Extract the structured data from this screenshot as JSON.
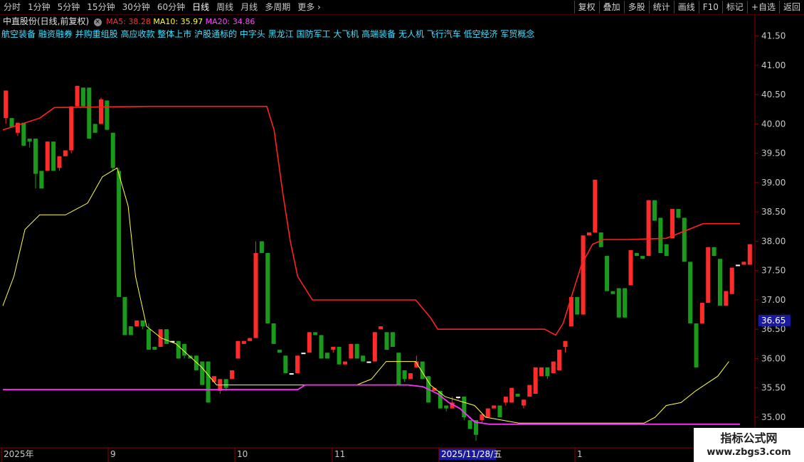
{
  "toolbar": {
    "timeframes": [
      "分时",
      "1分钟",
      "5分钟",
      "15分钟",
      "30分钟",
      "60分钟",
      "日线",
      "周线",
      "月线",
      "多周期",
      "更多"
    ],
    "active_timeframe": "日线",
    "more_chevron": "›",
    "tools": [
      "复权",
      "叠加",
      "多股",
      "统计",
      "画线",
      "F10",
      "标记",
      "+自选",
      "返回"
    ]
  },
  "info": {
    "stock_name": "中直股份(日线,前复权)",
    "close_icon": "×",
    "ma5_label": "MA5: 38.28",
    "ma10_label": "MA10: 35.97",
    "ma20_label": "MA20: 34.86"
  },
  "concepts": "航空装备 融资融券 并购重组股 高应收款 整体上市 沪股通标的 中字头 黑龙江 国防军工 大飞机 高端装备 无人机 飞行汽车 低空经济 军贸概念",
  "price_axis": {
    "labels": [
      "41.50",
      "41.00",
      "40.50",
      "40.00",
      "39.50",
      "39.00",
      "38.50",
      "38.00",
      "37.50",
      "37.00",
      "36.50",
      "36.00",
      "35.50",
      "35.00"
    ],
    "current_price": "36.65"
  },
  "time_axis": {
    "labels": [
      "2025年",
      "9",
      "10",
      "11",
      "2025/11/28/五",
      "1"
    ]
  },
  "colors": {
    "up": "#ff2b2b",
    "down": "#1a9a1a",
    "ma5": "#ff2020",
    "ma10": "#ffff40",
    "ma20": "#ff30ff",
    "axis": "#8b0000",
    "price_highlight_bg": "#1a1aa0"
  },
  "watermark": {
    "title": "指标公式网",
    "url": "www.zbgs3.com"
  },
  "chart_data": {
    "type": "candlestick",
    "ylim": [
      34.6,
      41.75
    ],
    "candles": [
      {
        "o": 40.1,
        "c": 40.57,
        "h": 40.57,
        "l": 40.0
      },
      {
        "o": 40.1,
        "c": 39.95,
        "h": 40.1,
        "l": 39.95
      },
      {
        "o": 39.85,
        "c": 40.02,
        "h": 40.02,
        "l": 39.8
      },
      {
        "o": 40.02,
        "c": 39.63,
        "h": 40.02,
        "l": 39.63
      },
      {
        "o": 39.75,
        "c": 39.7,
        "h": 39.75,
        "l": 39.6
      },
      {
        "o": 39.75,
        "c": 39.15,
        "h": 39.75,
        "l": 38.9
      },
      {
        "o": 39.2,
        "c": 38.9,
        "h": 39.2,
        "l": 38.9
      },
      {
        "o": 39.2,
        "c": 39.7,
        "h": 39.7,
        "l": 39.2
      },
      {
        "o": 39.7,
        "c": 39.2,
        "h": 39.7,
        "l": 39.2
      },
      {
        "o": 39.25,
        "c": 39.45,
        "h": 39.45,
        "l": 39.2
      },
      {
        "o": 39.45,
        "c": 39.55,
        "h": 39.55,
        "l": 39.45
      },
      {
        "o": 39.55,
        "c": 40.3,
        "h": 40.3,
        "l": 39.5
      },
      {
        "o": 40.3,
        "c": 40.65,
        "h": 40.65,
        "l": 40.3
      },
      {
        "o": 40.62,
        "c": 40.3,
        "h": 40.62,
        "l": 40.3
      },
      {
        "o": 40.62,
        "c": 39.75,
        "h": 40.62,
        "l": 39.75
      },
      {
        "o": 40.0,
        "c": 39.85,
        "h": 40.0,
        "l": 39.85
      },
      {
        "o": 40.0,
        "c": 40.42,
        "h": 40.45,
        "l": 40.0
      },
      {
        "o": 40.4,
        "c": 39.9,
        "h": 40.4,
        "l": 39.9
      },
      {
        "o": 39.85,
        "c": 39.25,
        "h": 39.85,
        "l": 39.2
      },
      {
        "o": 39.2,
        "c": 37.05,
        "h": 39.25,
        "l": 37.05
      },
      {
        "o": 37.05,
        "c": 36.4,
        "h": 37.05,
        "l": 36.4
      },
      {
        "o": 36.55,
        "c": 36.4,
        "h": 36.55,
        "l": 36.4
      },
      {
        "o": 36.55,
        "c": 36.65,
        "h": 36.65,
        "l": 36.55
      },
      {
        "o": 36.65,
        "c": 36.55,
        "h": 36.65,
        "l": 36.5
      },
      {
        "o": 36.5,
        "c": 36.15,
        "h": 36.6,
        "l": 36.15
      },
      {
        "o": 36.2,
        "c": 36.15,
        "h": 36.2,
        "l": 36.15
      },
      {
        "o": 36.2,
        "c": 36.5,
        "h": 36.5,
        "l": 36.2
      },
      {
        "o": 36.5,
        "c": 36.25,
        "h": 36.5,
        "l": 36.25
      },
      {
        "o": 36.3,
        "c": 36.3,
        "h": 36.3,
        "l": 36.3
      },
      {
        "o": 36.3,
        "c": 36.0,
        "h": 36.3,
        "l": 36.0
      },
      {
        "o": 36.25,
        "c": 36.05,
        "h": 36.25,
        "l": 36.0
      },
      {
        "o": 36.05,
        "c": 36.0,
        "h": 36.05,
        "l": 36.0
      },
      {
        "o": 36.05,
        "c": 35.8,
        "h": 36.05,
        "l": 35.8
      },
      {
        "o": 35.95,
        "c": 35.55,
        "h": 35.95,
        "l": 35.55
      },
      {
        "o": 35.95,
        "c": 35.25,
        "h": 35.95,
        "l": 35.25
      },
      {
        "o": 35.6,
        "c": 35.7,
        "h": 35.7,
        "l": 35.6
      },
      {
        "o": 35.45,
        "c": 35.65,
        "h": 35.65,
        "l": 35.4
      },
      {
        "o": 35.65,
        "c": 35.5,
        "h": 35.65,
        "l": 35.45
      },
      {
        "o": 35.65,
        "c": 35.8,
        "h": 35.8,
        "l": 35.65
      },
      {
        "o": 36.0,
        "c": 36.3,
        "h": 36.3,
        "l": 36.0
      },
      {
        "o": 36.25,
        "c": 36.3,
        "h": 36.3,
        "l": 36.25
      },
      {
        "o": 36.3,
        "c": 36.35,
        "h": 36.35,
        "l": 36.3
      },
      {
        "o": 36.35,
        "c": 37.8,
        "h": 38.0,
        "l": 36.35
      },
      {
        "o": 38.0,
        "c": 37.8,
        "h": 38.0,
        "l": 37.8
      },
      {
        "o": 37.8,
        "c": 36.6,
        "h": 37.8,
        "l": 36.6
      },
      {
        "o": 36.6,
        "c": 36.25,
        "h": 36.6,
        "l": 36.25
      },
      {
        "o": 36.15,
        "c": 36.1,
        "h": 36.15,
        "l": 36.1
      },
      {
        "o": 36.05,
        "c": 35.75,
        "h": 36.05,
        "l": 35.75
      },
      {
        "o": 35.75,
        "c": 35.75,
        "h": 35.75,
        "l": 35.75
      },
      {
        "o": 35.75,
        "c": 36.05,
        "h": 36.05,
        "l": 35.75
      },
      {
        "o": 36.1,
        "c": 36.1,
        "h": 36.1,
        "l": 36.1
      },
      {
        "o": 36.1,
        "c": 36.45,
        "h": 36.45,
        "l": 36.1
      },
      {
        "o": 36.45,
        "c": 36.4,
        "h": 36.45,
        "l": 36.4
      },
      {
        "o": 36.4,
        "c": 36.0,
        "h": 36.4,
        "l": 36.0
      },
      {
        "o": 36.1,
        "c": 36.0,
        "h": 36.1,
        "l": 36.0
      },
      {
        "o": 36.15,
        "c": 36.2,
        "h": 36.2,
        "l": 36.1
      },
      {
        "o": 36.2,
        "c": 35.9,
        "h": 36.2,
        "l": 35.9
      },
      {
        "o": 35.9,
        "c": 35.95,
        "h": 35.95,
        "l": 35.9
      },
      {
        "o": 36.0,
        "c": 36.25,
        "h": 36.25,
        "l": 36.0
      },
      {
        "o": 36.25,
        "c": 36.0,
        "h": 36.25,
        "l": 36.0
      },
      {
        "o": 36.05,
        "c": 35.95,
        "h": 36.05,
        "l": 35.95
      },
      {
        "o": 35.95,
        "c": 35.95,
        "h": 35.95,
        "l": 35.95
      },
      {
        "o": 35.95,
        "c": 36.45,
        "h": 36.45,
        "l": 35.95
      },
      {
        "o": 36.5,
        "c": 36.55,
        "h": 36.55,
        "l": 36.5
      },
      {
        "o": 36.45,
        "c": 36.15,
        "h": 36.45,
        "l": 36.15
      },
      {
        "o": 36.45,
        "c": 36.2,
        "h": 36.45,
        "l": 36.2
      },
      {
        "o": 36.1,
        "c": 35.55,
        "h": 36.1,
        "l": 35.55
      },
      {
        "o": 35.8,
        "c": 35.65,
        "h": 35.8,
        "l": 35.6
      },
      {
        "o": 35.65,
        "c": 35.75,
        "h": 35.75,
        "l": 35.65
      },
      {
        "o": 35.85,
        "c": 35.95,
        "h": 36.05,
        "l": 35.85
      },
      {
        "o": 35.95,
        "c": 35.65,
        "h": 35.95,
        "l": 35.65
      },
      {
        "o": 35.7,
        "c": 35.25,
        "h": 35.7,
        "l": 35.25
      },
      {
        "o": 35.45,
        "c": 35.5,
        "h": 35.5,
        "l": 35.45
      },
      {
        "o": 35.45,
        "c": 35.15,
        "h": 35.45,
        "l": 35.15
      },
      {
        "o": 35.2,
        "c": 35.15,
        "h": 35.2,
        "l": 35.1
      },
      {
        "o": 35.15,
        "c": 35.25,
        "h": 35.35,
        "l": 35.15
      },
      {
        "o": 35.35,
        "c": 35.35,
        "h": 35.35,
        "l": 35.3
      },
      {
        "o": 35.35,
        "c": 35.0,
        "h": 35.35,
        "l": 34.95
      },
      {
        "o": 34.95,
        "c": 34.8,
        "h": 34.95,
        "l": 34.8
      },
      {
        "o": 34.95,
        "c": 34.7,
        "h": 34.95,
        "l": 34.6
      },
      {
        "o": 34.95,
        "c": 35.05,
        "h": 35.05,
        "l": 34.9
      },
      {
        "o": 35.0,
        "c": 35.15,
        "h": 35.15,
        "l": 35.0
      },
      {
        "o": 35.15,
        "c": 35.2,
        "h": 35.2,
        "l": 35.15
      },
      {
        "o": 35.2,
        "c": 35.0,
        "h": 35.2,
        "l": 35.0
      },
      {
        "o": 35.25,
        "c": 35.35,
        "h": 35.35,
        "l": 35.2
      },
      {
        "o": 35.25,
        "c": 35.5,
        "h": 35.5,
        "l": 35.25
      },
      {
        "o": 35.4,
        "c": 35.35,
        "h": 35.4,
        "l": 35.35
      },
      {
        "o": 35.2,
        "c": 35.3,
        "h": 35.3,
        "l": 35.15
      },
      {
        "o": 35.35,
        "c": 35.55,
        "h": 35.55,
        "l": 35.35
      },
      {
        "o": 35.4,
        "c": 35.85,
        "h": 35.85,
        "l": 35.4
      },
      {
        "o": 35.7,
        "c": 35.85,
        "h": 35.85,
        "l": 35.7
      },
      {
        "o": 35.85,
        "c": 35.7,
        "h": 35.85,
        "l": 35.65
      },
      {
        "o": 35.75,
        "c": 35.95,
        "h": 35.95,
        "l": 35.75
      },
      {
        "o": 35.8,
        "c": 36.15,
        "h": 36.15,
        "l": 35.8
      },
      {
        "o": 36.2,
        "c": 36.3,
        "h": 36.3,
        "l": 36.1
      },
      {
        "o": 36.55,
        "c": 37.05,
        "h": 37.05,
        "l": 36.55
      },
      {
        "o": 37.05,
        "c": 36.75,
        "h": 37.05,
        "l": 36.75
      },
      {
        "o": 36.75,
        "c": 38.1,
        "h": 38.1,
        "l": 36.75
      },
      {
        "o": 38.1,
        "c": 38.15,
        "h": 38.15,
        "l": 38.1
      },
      {
        "o": 38.15,
        "c": 39.05,
        "h": 39.05,
        "l": 38.15
      },
      {
        "o": 38.15,
        "c": 37.9,
        "h": 38.15,
        "l": 37.9
      },
      {
        "o": 37.75,
        "c": 37.15,
        "h": 37.75,
        "l": 37.15
      },
      {
        "o": 37.15,
        "c": 37.1,
        "h": 37.15,
        "l": 37.1
      },
      {
        "o": 37.2,
        "c": 36.7,
        "h": 37.2,
        "l": 36.7
      },
      {
        "o": 37.2,
        "c": 36.7,
        "h": 37.2,
        "l": 36.7
      },
      {
        "o": 37.25,
        "c": 37.85,
        "h": 37.85,
        "l": 37.25
      },
      {
        "o": 37.8,
        "c": 37.75,
        "h": 37.8,
        "l": 37.75
      },
      {
        "o": 37.75,
        "c": 37.7,
        "h": 37.7,
        "l": 37.7
      },
      {
        "o": 37.75,
        "c": 38.7,
        "h": 38.7,
        "l": 37.75
      },
      {
        "o": 38.7,
        "c": 38.35,
        "h": 38.7,
        "l": 38.35
      },
      {
        "o": 38.4,
        "c": 37.8,
        "h": 38.4,
        "l": 37.8
      },
      {
        "o": 37.95,
        "c": 37.75,
        "h": 37.95,
        "l": 37.75
      },
      {
        "o": 38.05,
        "c": 38.55,
        "h": 38.55,
        "l": 38.05
      },
      {
        "o": 38.55,
        "c": 38.4,
        "h": 38.55,
        "l": 38.4
      },
      {
        "o": 38.4,
        "c": 37.65,
        "h": 38.4,
        "l": 37.65
      },
      {
        "o": 37.65,
        "c": 36.6,
        "h": 37.65,
        "l": 36.6
      },
      {
        "o": 36.6,
        "c": 35.85,
        "h": 36.6,
        "l": 35.85
      },
      {
        "o": 36.6,
        "c": 36.95,
        "h": 36.95,
        "l": 36.6
      },
      {
        "o": 36.95,
        "c": 37.9,
        "h": 37.9,
        "l": 36.95
      },
      {
        "o": 37.9,
        "c": 37.75,
        "h": 37.9,
        "l": 37.75
      },
      {
        "o": 37.7,
        "c": 36.9,
        "h": 37.7,
        "l": 36.9
      },
      {
        "o": 36.9,
        "c": 37.15,
        "h": 37.15,
        "l": 36.9
      },
      {
        "o": 37.1,
        "c": 37.55,
        "h": 37.55,
        "l": 37.1
      },
      {
        "o": 37.6,
        "c": 37.6,
        "h": 37.6,
        "l": 37.6
      },
      {
        "o": 37.6,
        "c": 37.65,
        "h": 37.65,
        "l": 37.6
      },
      {
        "o": 37.6,
        "c": 37.95,
        "h": 37.95,
        "l": 37.6
      }
    ],
    "lines": {
      "ma5": [
        [
          0,
          39.9
        ],
        [
          0.05,
          40.1
        ],
        [
          0.07,
          40.28
        ],
        [
          0.2,
          40.3
        ],
        [
          0.33,
          40.3
        ],
        [
          0.358,
          40.3
        ],
        [
          0.368,
          39.9
        ],
        [
          0.38,
          38.8
        ],
        [
          0.39,
          38.0
        ],
        [
          0.4,
          37.4
        ],
        [
          0.42,
          37.0
        ],
        [
          0.53,
          37.0
        ],
        [
          0.56,
          37.0
        ],
        [
          0.58,
          36.7
        ],
        [
          0.59,
          36.5
        ],
        [
          0.65,
          36.5
        ],
        [
          0.735,
          36.5
        ],
        [
          0.75,
          36.4
        ],
        [
          0.76,
          36.6
        ],
        [
          0.77,
          37.0
        ],
        [
          0.785,
          37.6
        ],
        [
          0.8,
          37.95
        ],
        [
          0.815,
          38.03
        ],
        [
          0.85,
          38.03
        ],
        [
          0.9,
          38.05
        ],
        [
          0.95,
          38.3
        ],
        [
          1.0,
          38.3
        ]
      ],
      "ma10": [
        [
          0,
          36.9
        ],
        [
          0.015,
          37.4
        ],
        [
          0.03,
          38.2
        ],
        [
          0.05,
          38.45
        ],
        [
          0.085,
          38.45
        ],
        [
          0.1,
          38.55
        ],
        [
          0.115,
          38.65
        ],
        [
          0.135,
          39.1
        ],
        [
          0.155,
          39.25
        ],
        [
          0.17,
          38.6
        ],
        [
          0.18,
          37.4
        ],
        [
          0.195,
          36.55
        ],
        [
          0.215,
          36.35
        ],
        [
          0.235,
          36.25
        ],
        [
          0.27,
          35.85
        ],
        [
          0.29,
          35.55
        ],
        [
          0.34,
          35.55
        ],
        [
          0.48,
          35.55
        ],
        [
          0.5,
          35.65
        ],
        [
          0.52,
          35.95
        ],
        [
          0.56,
          35.95
        ],
        [
          0.57,
          35.75
        ],
        [
          0.58,
          35.55
        ],
        [
          0.6,
          35.35
        ],
        [
          0.64,
          35.2
        ],
        [
          0.655,
          35.0
        ],
        [
          0.7,
          34.9
        ],
        [
          0.87,
          34.9
        ],
        [
          0.885,
          35.0
        ],
        [
          0.9,
          35.2
        ],
        [
          0.92,
          35.25
        ],
        [
          0.94,
          35.45
        ],
        [
          0.97,
          35.7
        ],
        [
          0.985,
          35.95
        ]
      ],
      "ma20": [
        [
          0,
          35.47
        ],
        [
          0.4,
          35.47
        ],
        [
          0.41,
          35.55
        ],
        [
          0.55,
          35.55
        ],
        [
          0.57,
          35.52
        ],
        [
          0.59,
          35.4
        ],
        [
          0.605,
          35.25
        ],
        [
          0.62,
          35.15
        ],
        [
          0.64,
          34.92
        ],
        [
          0.66,
          34.88
        ],
        [
          0.8,
          34.88
        ],
        [
          1.0,
          34.88
        ]
      ]
    }
  }
}
